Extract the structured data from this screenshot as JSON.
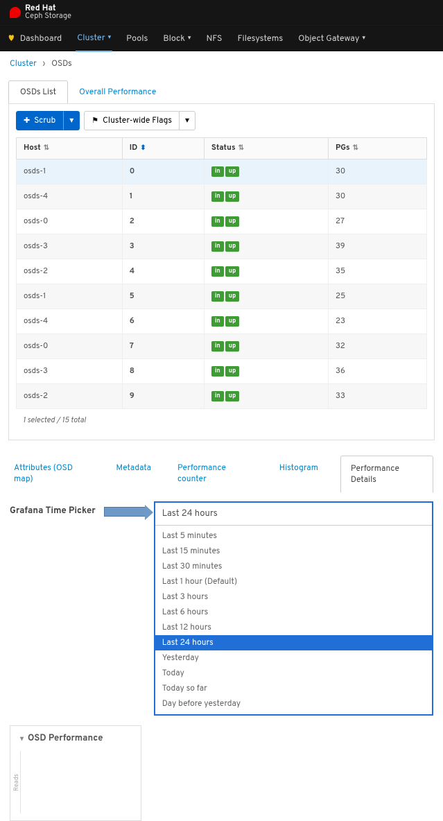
{
  "brand": {
    "name": "Red Hat",
    "product": "Ceph Storage"
  },
  "nav": {
    "dashboard": "Dashboard",
    "cluster": "Cluster",
    "pools": "Pools",
    "block": "Block",
    "nfs": "NFS",
    "filesystems": "Filesystems",
    "object_gateway": "Object Gateway"
  },
  "breadcrumb": {
    "root": "Cluster",
    "current": "OSDs"
  },
  "tabs": {
    "osds_list": "OSDs List",
    "overall_perf": "Overall Performance"
  },
  "toolbar": {
    "scrub": "Scrub",
    "cluster_flags": "Cluster-wide Flags"
  },
  "columns": {
    "host": "Host",
    "id": "ID",
    "status": "Status",
    "pgs": "PGs"
  },
  "status_badges": {
    "in": "in",
    "up": "up"
  },
  "rows": [
    {
      "host": "osds-1",
      "id": "0",
      "pgs": "30",
      "selected": true
    },
    {
      "host": "osds-4",
      "id": "1",
      "pgs": "30"
    },
    {
      "host": "osds-0",
      "id": "2",
      "pgs": "27"
    },
    {
      "host": "osds-3",
      "id": "3",
      "pgs": "39"
    },
    {
      "host": "osds-2",
      "id": "4",
      "pgs": "35"
    },
    {
      "host": "osds-1",
      "id": "5",
      "pgs": "25"
    },
    {
      "host": "osds-4",
      "id": "6",
      "pgs": "23"
    },
    {
      "host": "osds-0",
      "id": "7",
      "pgs": "32"
    },
    {
      "host": "osds-3",
      "id": "8",
      "pgs": "36"
    },
    {
      "host": "osds-2",
      "id": "9",
      "pgs": "33"
    }
  ],
  "selection_status": "1 selected / 15 total",
  "subtabs": {
    "attributes": "Attributes (OSD map)",
    "metadata": "Metadata",
    "perf_counter": "Performance counter",
    "histogram": "Histogram",
    "perf_details": "Performance Details"
  },
  "time_picker": {
    "label": "Grafana Time Picker",
    "value": "Last 24 hours",
    "options": [
      "Last 5 minutes",
      "Last 15 minutes",
      "Last 30 minutes",
      "Last 1 hour (Default)",
      "Last 3 hours",
      "Last 6 hours",
      "Last 12 hours",
      "Last 24 hours",
      "Yesterday",
      "Today",
      "Today so far",
      "Day before yesterday"
    ],
    "highlighted": "Last 24 hours"
  },
  "perf_card": {
    "title": "OSD Performance",
    "ylab": "Reads"
  }
}
